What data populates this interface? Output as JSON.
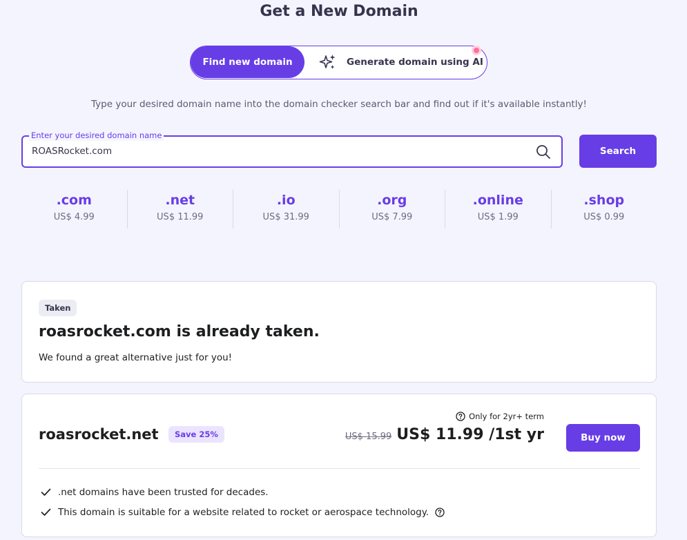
{
  "page": {
    "title": "Get a New Domain",
    "subtitle": "Type your desired domain name into the domain checker search bar and find out if it's available instantly!"
  },
  "toggle": {
    "find_label": "Find new domain",
    "ai_label": "Generate domain using AI"
  },
  "search": {
    "label": "Enter your desired domain name",
    "value": "ROASRocket.com",
    "button_label": "Search"
  },
  "tlds": [
    {
      "name": ".com",
      "price": "US$ 4.99"
    },
    {
      "name": ".net",
      "price": "US$ 11.99"
    },
    {
      "name": ".io",
      "price": "US$ 31.99"
    },
    {
      "name": ".org",
      "price": "US$ 7.99"
    },
    {
      "name": ".online",
      "price": "US$ 1.99"
    },
    {
      "name": ".shop",
      "price": "US$ 0.99"
    }
  ],
  "taken": {
    "badge": "Taken",
    "heading": "roasrocket.com is already taken.",
    "subtext": "We found a great alternative just for you!"
  },
  "alternative": {
    "domain": "roasrocket.net",
    "save_badge": "Save 25%",
    "term_note": "Only for 2yr+ term",
    "old_price": "US$ 15.99",
    "new_price": "US$ 11.99 /1st yr",
    "buy_label": "Buy now",
    "features": [
      ".net domains have been trusted for decades.",
      "This domain is suitable for a website related to rocket or aerospace technology."
    ]
  },
  "icons": {
    "sparkle": "sparkles-icon",
    "search": "search-icon",
    "help": "question-circle-icon",
    "check": "check-icon"
  },
  "colors": {
    "accent": "#673de6",
    "background": "#f4f4ff",
    "notification_dot": "#ff6ea0"
  }
}
